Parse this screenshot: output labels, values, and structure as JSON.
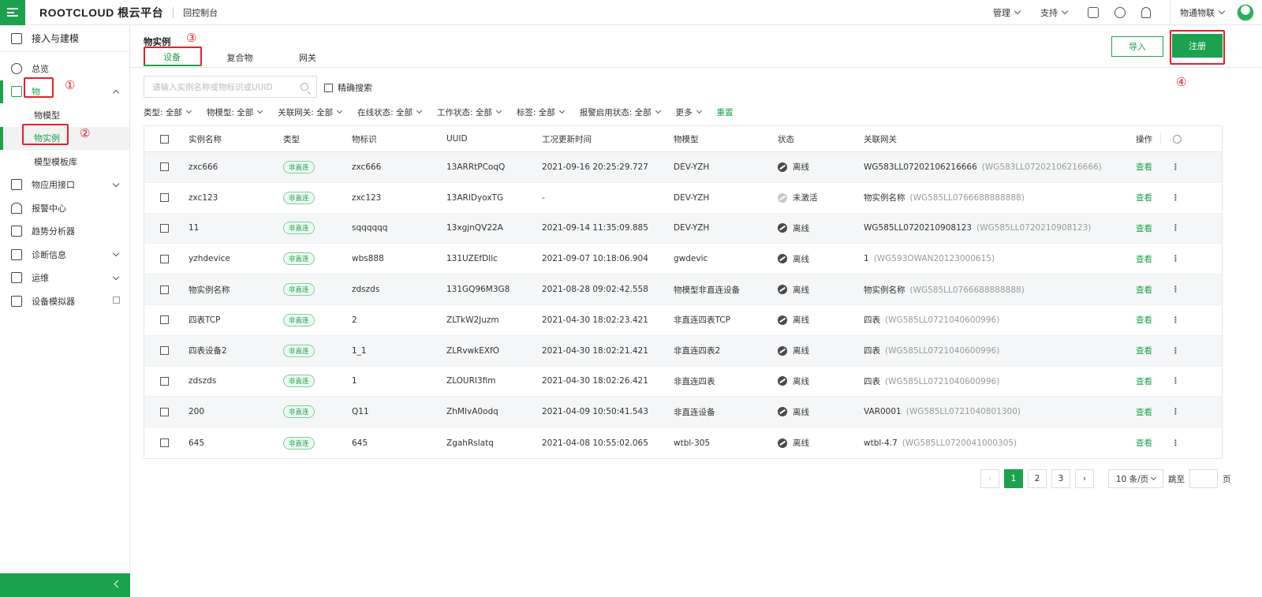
{
  "topbar": {
    "logo": "ROOTCLOUD 根云平台",
    "console": "回控制台",
    "menus": [
      {
        "label": "管理"
      },
      {
        "label": "支持"
      }
    ],
    "user": "物通物联"
  },
  "sidebar": {
    "header": "接入与建模",
    "items": [
      {
        "label": "总览"
      },
      {
        "label": "物",
        "expanded": true
      },
      {
        "label": "物模型"
      },
      {
        "label": "物实例"
      },
      {
        "label": "模型模板库"
      },
      {
        "label": "物应用接口"
      },
      {
        "label": "报警中心"
      },
      {
        "label": "趋势分析器"
      },
      {
        "label": "诊断信息"
      },
      {
        "label": "运维"
      },
      {
        "label": "设备模拟器"
      }
    ]
  },
  "annotations": [
    "①",
    "②",
    "③",
    "④"
  ],
  "page": {
    "title": "物实例",
    "tabs": [
      "设备",
      "复合物",
      "网关"
    ],
    "import_label": "导入",
    "register_label": "注册"
  },
  "search": {
    "placeholder": "请输入实例名称或物标识或UUID",
    "exact_label": "精确搜索"
  },
  "filters": [
    "类型: 全部",
    "物模型: 全部",
    "关联网关: 全部",
    "在线状态: 全部",
    "工作状态: 全部",
    "标签: 全部",
    "报警启用状态: 全部",
    "更多"
  ],
  "reset_label": "重置",
  "table": {
    "columns": [
      "实例名称",
      "类型",
      "物标识",
      "UUID",
      "工况更新时间",
      "物模型",
      "状态",
      "关联网关",
      "操作"
    ],
    "rows": [
      {
        "name": "zxc666",
        "type": "非直连",
        "id": "zxc666",
        "uuid": "13ARRtPCoqQ",
        "time": "2021-09-16 20:25:29.727",
        "model": "DEV-YZH",
        "status": "离线",
        "gw": "WG583LL07202106216666",
        "gw_sub": "(WG583LL07202106216666)",
        "op": "查看"
      },
      {
        "name": "zxc123",
        "type": "非直连",
        "id": "zxc123",
        "uuid": "13ARIDyoxTG",
        "time": "-",
        "model": "DEV-YZH",
        "status": "未激活",
        "gw": "物实例名称",
        "gw_sub": "(WG585LL0766688888888)",
        "op": "查看"
      },
      {
        "name": "11",
        "type": "非直连",
        "id": "sqqqqqq",
        "uuid": "13xgjnQV22A",
        "time": "2021-09-14 11:35:09.885",
        "model": "DEV-YZH",
        "status": "离线",
        "gw": "WG585LL0720210908123",
        "gw_sub": "(WG585LL0720210908123)",
        "op": "查看"
      },
      {
        "name": "yzhdevice",
        "type": "非直连",
        "id": "wbs888",
        "uuid": "131UZEfDIlc",
        "time": "2021-09-07 10:18:06.904",
        "model": "gwdevic",
        "status": "离线",
        "gw": "1",
        "gw_sub": "(WG593OWAN20123000615)",
        "op": "查看"
      },
      {
        "name": "物实例名称",
        "type": "非直连",
        "id": "zdszds",
        "uuid": "131GQ96M3G8",
        "time": "2021-08-28 09:02:42.558",
        "model": "物模型非直连设备",
        "status": "离线",
        "gw": "物实例名称",
        "gw_sub": "(WG585LL0766688888888)",
        "op": "查看"
      },
      {
        "name": "四表TCP",
        "type": "非直连",
        "id": "2",
        "uuid": "ZLTkW2Juzm",
        "time": "2021-04-30 18:02:23.421",
        "model": "非直连四表TCP",
        "status": "离线",
        "gw": "四表",
        "gw_sub": "(WG585LL0721040600996)",
        "op": "查看"
      },
      {
        "name": "四表设备2",
        "type": "非直连",
        "id": "1_1",
        "uuid": "ZLRvwkEXfO",
        "time": "2021-04-30 18:02:21.421",
        "model": "非直连四表2",
        "status": "离线",
        "gw": "四表",
        "gw_sub": "(WG585LL0721040600996)",
        "op": "查看"
      },
      {
        "name": "zdszds",
        "type": "非直连",
        "id": "1",
        "uuid": "ZLOURI3fim",
        "time": "2021-04-30 18:02:26.421",
        "model": "非直连四表",
        "status": "离线",
        "gw": "四表",
        "gw_sub": "(WG585LL0721040600996)",
        "op": "查看"
      },
      {
        "name": "200",
        "type": "非直连",
        "id": "Q11",
        "uuid": "ZhMIvA0odq",
        "time": "2021-04-09 10:50:41.543",
        "model": "非直连设备",
        "status": "离线",
        "gw": "VAR0001",
        "gw_sub": "(WG585LL0721040801300)",
        "op": "查看"
      },
      {
        "name": "645",
        "type": "非直连",
        "id": "645",
        "uuid": "ZgahRslatq",
        "time": "2021-04-08 10:55:02.065",
        "model": "wtbl-305",
        "status": "离线",
        "gw": "wtbl-4.7",
        "gw_sub": "(WG585LL0720041000305)",
        "op": "查看"
      }
    ]
  },
  "pagination": {
    "pages": [
      "1",
      "2",
      "3"
    ],
    "current": "1",
    "page_size": "10 条/页",
    "jump_label": "跳至",
    "page_unit": "页"
  },
  "colors": {
    "accent": "#1ba24d",
    "annotation": "#e5202b"
  }
}
